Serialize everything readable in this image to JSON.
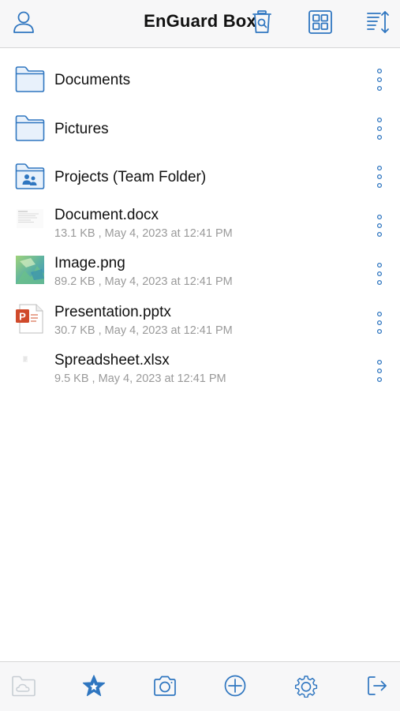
{
  "app": {
    "title": "EnGuard Box"
  },
  "colors": {
    "accent": "#2f76c0",
    "folder_fill": "#e8f1fb",
    "meta_text": "#9a9a9a",
    "disabled": "#c7cdd3"
  },
  "header": {
    "buttons": [
      {
        "icon": "account-icon"
      },
      {
        "icon": "trash-search-icon"
      },
      {
        "icon": "grid-view-icon"
      },
      {
        "icon": "sort-icon"
      }
    ]
  },
  "items": [
    {
      "name": "Documents",
      "kind": "folder",
      "icon": "folder-icon"
    },
    {
      "name": "Pictures",
      "kind": "folder",
      "icon": "folder-icon"
    },
    {
      "name": "Projects (Team Folder)",
      "kind": "team-folder",
      "icon": "team-folder-icon"
    },
    {
      "name": "Document.docx",
      "kind": "file",
      "icon": "document-thumbnail",
      "meta": "13.1 KB , May 4, 2023 at 12:41 PM"
    },
    {
      "name": "Image.png",
      "kind": "file",
      "icon": "image-thumbnail",
      "meta": "89.2 KB , May 4, 2023 at 12:41 PM"
    },
    {
      "name": "Presentation.pptx",
      "kind": "file",
      "icon": "powerpoint-icon",
      "meta": "30.7 KB , May 4, 2023 at 12:41 PM"
    },
    {
      "name": "Spreadsheet.xlsx",
      "kind": "file",
      "icon": "spreadsheet-thumbnail",
      "meta": "9.5 KB , May 4, 2023 at 12:41 PM"
    }
  ],
  "tabbar": {
    "tabs": [
      {
        "icon": "cloud-folder-icon",
        "state": "disabled"
      },
      {
        "icon": "star-icon",
        "state": "active"
      },
      {
        "icon": "camera-icon",
        "state": "normal"
      },
      {
        "icon": "add-circle-icon",
        "state": "normal"
      },
      {
        "icon": "gear-icon",
        "state": "normal"
      },
      {
        "icon": "logout-icon",
        "state": "normal"
      }
    ]
  }
}
